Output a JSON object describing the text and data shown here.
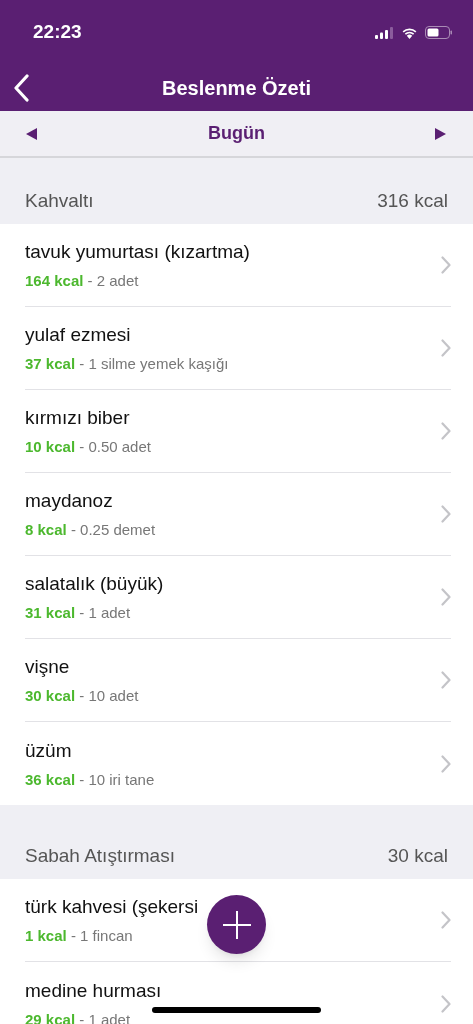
{
  "status_bar": {
    "time": "22:23"
  },
  "nav": {
    "title": "Beslenme Özeti"
  },
  "date_bar": {
    "label": "Bugün"
  },
  "sections": [
    {
      "title": "Kahvaltı",
      "total": "316 kcal",
      "items": [
        {
          "name": "tavuk yumurtası (kızartma)",
          "kcal": "164 kcal",
          "amount": "- 2 adet"
        },
        {
          "name": "yulaf ezmesi",
          "kcal": "37 kcal",
          "amount": "- 1 silme yemek kaşığı"
        },
        {
          "name": "kırmızı biber",
          "kcal": "10 kcal",
          "amount": "- 0.50 adet"
        },
        {
          "name": "maydanoz",
          "kcal": "8 kcal",
          "amount": "- 0.25 demet"
        },
        {
          "name": "salatalık (büyük)",
          "kcal": "31 kcal",
          "amount": "- 1 adet"
        },
        {
          "name": "vişne",
          "kcal": "30 kcal",
          "amount": "- 10 adet"
        },
        {
          "name": "üzüm",
          "kcal": "36 kcal",
          "amount": "- 10 iri tane"
        }
      ]
    },
    {
      "title": "Sabah Atıştırması",
      "total": "30 kcal",
      "items": [
        {
          "name": "türk kahvesi (şekersi",
          "kcal": "1 kcal",
          "amount": "- 1 fincan"
        },
        {
          "name": "medine hurması",
          "kcal": "29 kcal",
          "amount": "- 1 adet"
        }
      ]
    }
  ]
}
